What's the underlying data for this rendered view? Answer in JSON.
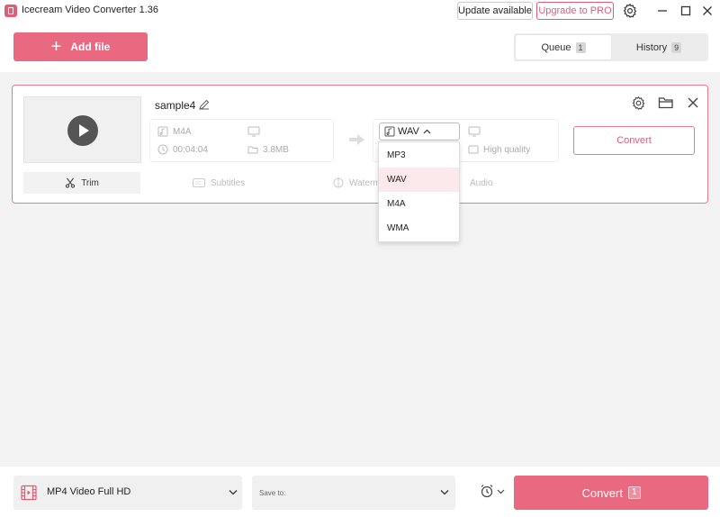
{
  "app": {
    "title": "Icecream Video Converter 1.36"
  },
  "titlebar": {
    "update_label": "Update available",
    "upgrade_label": "Upgrade to PRO"
  },
  "toolbar": {
    "add_file_label": "Add file"
  },
  "tabs": [
    {
      "label": "Queue",
      "count": "1"
    },
    {
      "label": "History",
      "count": "9"
    }
  ],
  "file": {
    "name": "sample4",
    "source_format": "M4A",
    "duration": "00:04:04",
    "size": "3.8MB",
    "target_format": "WAV",
    "quality": "High quality",
    "convert_label": "Convert"
  },
  "subtabs": {
    "trim": "Trim",
    "subtitles": "Subtitles",
    "watermark": "Waterm",
    "audio": "Audio"
  },
  "dropdown": {
    "options": [
      "MP3",
      "WAV",
      "M4A",
      "WMA"
    ],
    "selected": "WAV"
  },
  "footer": {
    "preset": "MP4 Video Full HD",
    "save_to_label": "Save to:",
    "convert_label": "Convert",
    "convert_count": "1"
  },
  "colors": {
    "accent": "#e96a80",
    "accent_text": "#e05d75"
  }
}
